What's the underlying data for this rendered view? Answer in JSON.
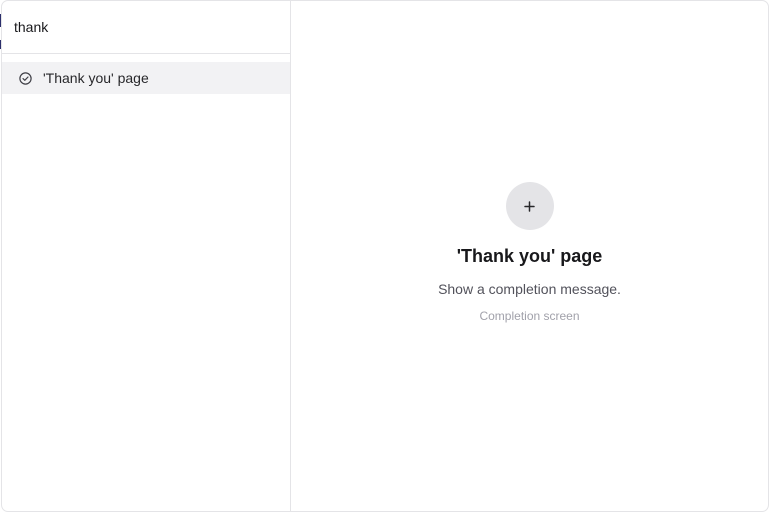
{
  "search": {
    "value": "thank",
    "placeholder": ""
  },
  "results": [
    {
      "label": "'Thank you' page",
      "icon": "check-circle-icon",
      "selected": true
    }
  ],
  "detail": {
    "action_icon": "plus-icon",
    "title": "'Thank you' page",
    "description": "Show a completion message.",
    "category": "Completion screen"
  },
  "colors": {
    "border": "#e4e4e7",
    "selected_row_bg": "#f2f2f4",
    "add_button_bg": "#e4e4e7",
    "title": "#18181b",
    "description": "#52525b",
    "category": "#a1a1aa"
  }
}
